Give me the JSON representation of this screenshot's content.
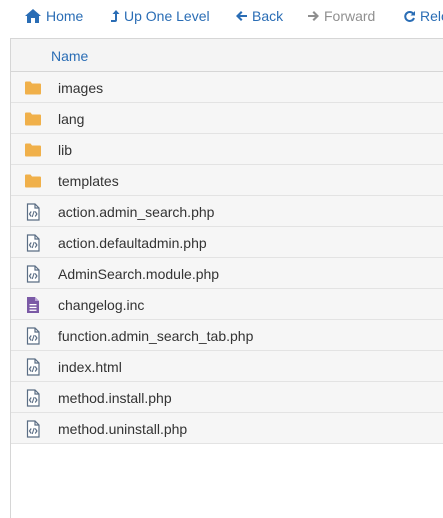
{
  "toolbar": {
    "home_label": "Home",
    "up_label": "Up One Level",
    "back_label": "Back",
    "forward_label": "Forward",
    "reload_label": "Relo"
  },
  "table": {
    "name_header": "Name",
    "rows": [
      {
        "name": "images",
        "icon": "folder-icon"
      },
      {
        "name": "lang",
        "icon": "folder-icon"
      },
      {
        "name": "lib",
        "icon": "folder-icon"
      },
      {
        "name": "templates",
        "icon": "folder-icon"
      },
      {
        "name": "action.admin_search.php",
        "icon": "code-file-icon"
      },
      {
        "name": "action.defaultadmin.php",
        "icon": "code-file-icon"
      },
      {
        "name": "AdminSearch.module.php",
        "icon": "code-file-icon"
      },
      {
        "name": "changelog.inc",
        "icon": "text-file-icon"
      },
      {
        "name": "function.admin_search_tab.php",
        "icon": "code-file-icon"
      },
      {
        "name": "index.html",
        "icon": "code-file-icon"
      },
      {
        "name": "method.install.php",
        "icon": "code-file-icon"
      },
      {
        "name": "method.uninstall.php",
        "icon": "code-file-icon"
      }
    ]
  },
  "colors": {
    "link": "#2a6db5",
    "disabled": "#8f8f8f",
    "folder": "#f0b04a",
    "text_file": "#7b5aa6",
    "code_file": "#5a6d84"
  }
}
